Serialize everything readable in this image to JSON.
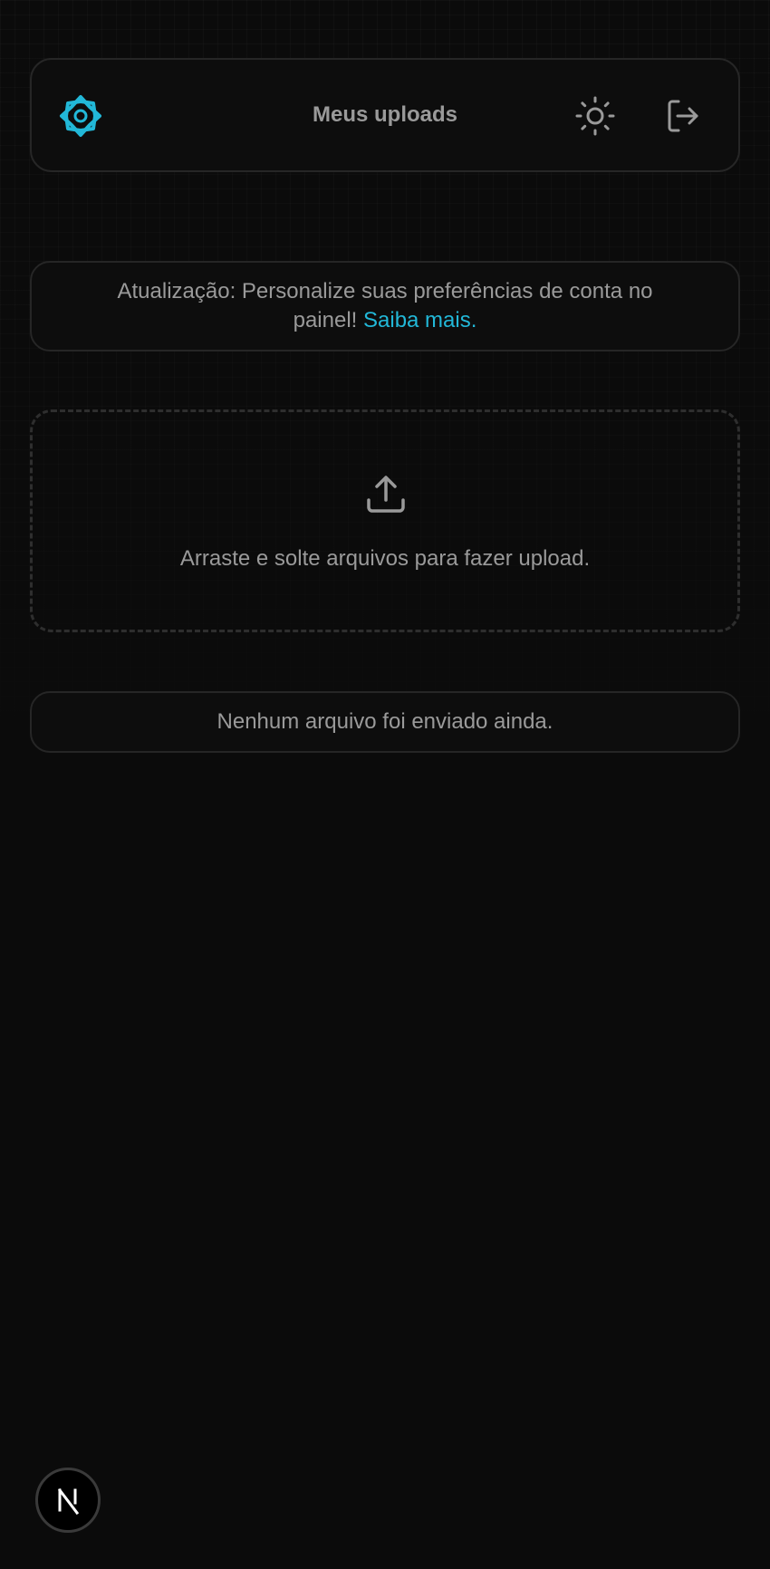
{
  "header": {
    "logo_icon": "snowflake-logo-icon",
    "title": "Meus uploads",
    "theme_toggle_icon": "sun-icon",
    "logout_icon": "logout-icon"
  },
  "banner": {
    "text": "Atualização: Personalize suas preferências de conta no painel!",
    "link_label": "Saiba mais."
  },
  "dropzone": {
    "icon": "upload-icon",
    "text": "Arraste e solte arquivos para fazer upload."
  },
  "files": {
    "empty_message": "Nenhum arquivo foi enviado ainda."
  },
  "dev_badge": {
    "letter": "N",
    "icon": "nextjs-icon"
  },
  "colors": {
    "background": "#0b0b0b",
    "accent": "#22b8d8",
    "text_muted": "#9a9a9a",
    "border": "#262626"
  }
}
